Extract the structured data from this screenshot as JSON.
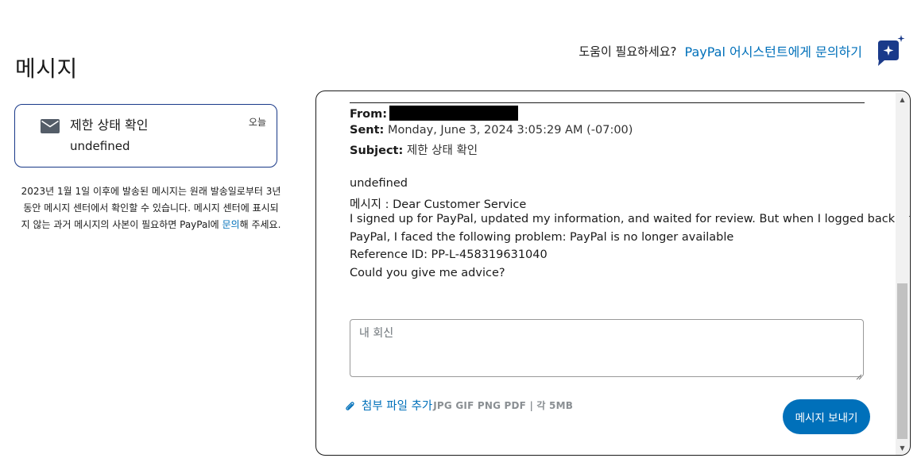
{
  "page": {
    "title": "메시지"
  },
  "help": {
    "question": "도움이 필요하세요?",
    "link": "PayPal 어시스턴트에게 문의하기",
    "icon": "assistant-chat-sparkle-icon"
  },
  "conversation_list": {
    "items": [
      {
        "subject": "제한 상태 확인",
        "preview": "undefined",
        "date": "오늘",
        "icon": "mail-icon"
      }
    ],
    "notice_before": "2023년 1월 1일 이후에 발송된 메시지는 원래 발송일로부터 3년 동안 메시지 센터에서 확인할 수 있습니다. 메시지 센터에 표시되지 않는 과거 메시지의 사본이 필요하면 PayPal에 ",
    "notice_link": "문의",
    "notice_after": "해 주세요."
  },
  "thread": {
    "from_label": "From:",
    "from_value": "",
    "sent_label": "Sent:",
    "sent_value": "Monday, June 3, 2024 3:05:29 AM (-07:00)",
    "subject_label": "Subject:",
    "subject_value": "제한 상태 확인",
    "body_lines": [
      "undefined",
      "메시지 : Dear Customer Service",
      "I signed up for PayPal, updated my information, and waited for review. But when I logged back into",
      "PayPal, I faced the following problem: PayPal is no longer available",
      "Reference ID: PP-L-458319631040",
      "Could you give me advice?"
    ]
  },
  "reply": {
    "placeholder": "내 회신",
    "value": ""
  },
  "attachment": {
    "link": "첨부 파일 추가",
    "types": "JPG GIF PNG PDF | 각 5MB",
    "icon": "paperclip-icon"
  },
  "actions": {
    "send": "메시지 보내기"
  },
  "colors": {
    "brand_blue": "#0070ba",
    "card_border": "#1a3a8a",
    "assistant_icon": "#1a3a8a"
  }
}
